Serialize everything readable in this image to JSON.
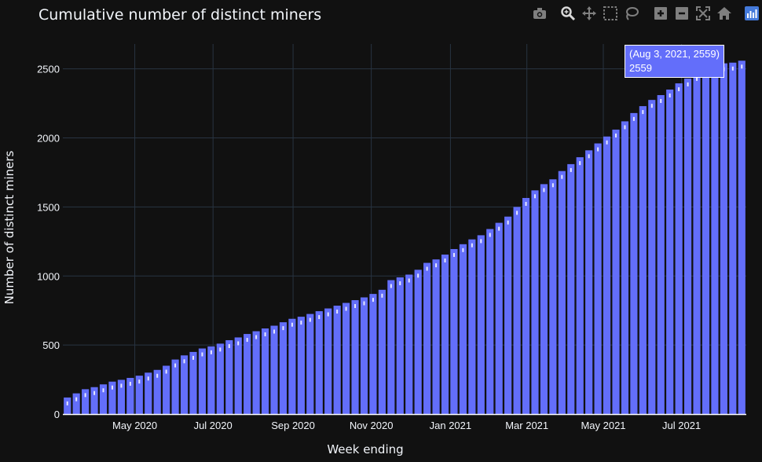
{
  "page": {
    "title": "Cumulative number of distinct miners"
  },
  "toolbar": {
    "buttons": [
      {
        "name": "camera-icon",
        "icon": "camera"
      },
      {
        "name": "zoom-icon",
        "icon": "zoom"
      },
      {
        "name": "pan-icon",
        "icon": "pan"
      },
      {
        "name": "box-select-icon",
        "icon": "box-select"
      },
      {
        "name": "lasso-select-icon",
        "icon": "lasso"
      },
      {
        "name": "zoom-in-icon",
        "icon": "zoom-in"
      },
      {
        "name": "zoom-out-icon",
        "icon": "zoom-out"
      },
      {
        "name": "autoscale-icon",
        "icon": "autoscale"
      },
      {
        "name": "reset-axes-icon",
        "icon": "home"
      },
      {
        "name": "plotly-logo-icon",
        "icon": "plotly-logo"
      }
    ]
  },
  "tooltip": {
    "line1": "(Aug 3, 2021, 2559)",
    "line2": "2559"
  },
  "colors": {
    "background": "#111111",
    "bar": "#636efa",
    "grid": "#283442",
    "text": "#f2f5fa",
    "toolbar_icon": "#7f7f7f"
  },
  "chart_data": {
    "type": "bar",
    "title": "Cumulative number of distinct miners",
    "xlabel": "Week ending",
    "ylabel": "Number of distinct miners",
    "ylim": [
      0,
      2680
    ],
    "yticks": [
      0,
      500,
      1000,
      1500,
      2000,
      2500
    ],
    "xticks": [
      {
        "label": "May 2020",
        "index": 7.5
      },
      {
        "label": "Jul 2020",
        "index": 16.2
      },
      {
        "label": "Sep 2020",
        "index": 25.1
      },
      {
        "label": "Nov 2020",
        "index": 33.8
      },
      {
        "label": "Jan 2021",
        "index": 42.6
      },
      {
        "label": "Mar 2021",
        "index": 51.1
      },
      {
        "label": "May 2021",
        "index": 59.6
      },
      {
        "label": "Jul 2021",
        "index": 68.3
      }
    ],
    "grid": true,
    "values": [
      120,
      150,
      180,
      195,
      215,
      235,
      248,
      262,
      278,
      300,
      320,
      350,
      395,
      425,
      450,
      475,
      490,
      510,
      535,
      555,
      580,
      600,
      620,
      640,
      665,
      690,
      705,
      725,
      745,
      765,
      785,
      805,
      825,
      845,
      870,
      900,
      970,
      990,
      1010,
      1045,
      1095,
      1120,
      1155,
      1195,
      1230,
      1265,
      1295,
      1340,
      1385,
      1430,
      1500,
      1565,
      1620,
      1665,
      1700,
      1760,
      1810,
      1860,
      1910,
      1960,
      2010,
      2060,
      2120,
      2180,
      2230,
      2275,
      2310,
      2350,
      2395,
      2430,
      2470,
      2500,
      2520,
      2540,
      2545,
      2559
    ]
  }
}
